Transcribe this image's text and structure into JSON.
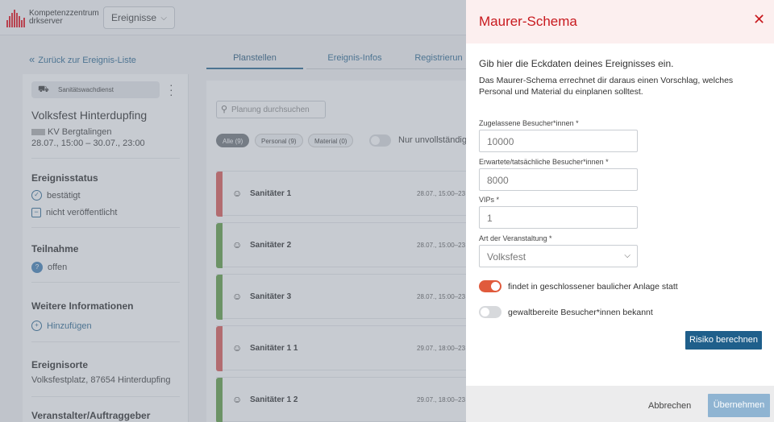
{
  "header": {
    "logo_line1": "Kompetenzzentrum",
    "logo_line2": "drkserver",
    "events_select": "Ereignisse"
  },
  "nav": {
    "back_label": "Zurück zur Ereignis-Liste",
    "tabs": [
      {
        "label": "Planstellen",
        "active": true
      },
      {
        "label": "Ereignis-Infos",
        "active": false
      },
      {
        "label": "Registrierun",
        "active": false
      }
    ]
  },
  "event": {
    "type_chip": "Sanitätswachdienst",
    "title": "Volksfest Hinterdupfing",
    "org": "KV Bergtalingen",
    "dates": "28.07., 15:00 – 30.07., 23:00",
    "status_heading": "Ereignisstatus",
    "status_confirmed": "bestätigt",
    "status_unpublished": "nicht veröffentlicht",
    "participation_heading": "Teilnahme",
    "participation_value": "offen",
    "more_info_heading": "Weitere Informationen",
    "add_label": "Hinzufügen",
    "locations_heading": "Ereignisorte",
    "location_value": "Volksfestplatz, 87654 Hinterdupfing",
    "organizer_heading": "Veranstalter/Auftraggeber"
  },
  "planning": {
    "search_placeholder": "Planung durchsuchen",
    "filters": [
      {
        "label": "Alle (9)",
        "active": true
      },
      {
        "label": "Personal (9)",
        "active": false
      },
      {
        "label": "Material (0)",
        "active": false
      }
    ],
    "incomplete_toggle_label": "Nur unvollständig b",
    "rows": [
      {
        "name": "Sanitäter 1",
        "date": "28.07., 15:00–23",
        "status_color": "#d9534f"
      },
      {
        "name": "Sanitäter 2",
        "date": "28.07., 15:00–23",
        "status_color": "#5a9a3c"
      },
      {
        "name": "Sanitäter 3",
        "date": "28.07., 15:00–23",
        "status_color": "#5a9a3c"
      },
      {
        "name": "Sanitäter 1 1",
        "date": "29.07., 18:00–23",
        "status_color": "#d9534f"
      },
      {
        "name": "Sanitäter 1 2",
        "date": "29.07., 18:00–23",
        "status_color": "#5a9a3c"
      }
    ]
  },
  "dialog": {
    "title": "Maurer-Schema",
    "intro": "Gib hier die Eckdaten deines Ereignisses ein.",
    "description": "Das Maurer-Schema errechnet dir daraus einen Vorschlag, welches Personal und Material du einplanen solltest.",
    "fields": {
      "allowed_visitors_label": "Zugelassene Besucher*innen *",
      "allowed_visitors_value": "10000",
      "expected_visitors_label": "Erwartete/tatsächliche Besucher*innen *",
      "expected_visitors_value": "8000",
      "vips_label": "VIPs *",
      "vips_value": "1",
      "event_type_label": "Art der Veranstaltung *",
      "event_type_value": "Volksfest"
    },
    "switches": {
      "enclosed_label": "findet in geschlossener baulicher Anlage statt",
      "enclosed_on": true,
      "violent_label": "gewaltbereite Besucher*innen bekannt",
      "violent_on": false
    },
    "calculate_label": "Risiko berechnen",
    "cancel_label": "Abbrechen",
    "apply_label": "Übernehmen"
  },
  "colors": {
    "accent": "#1f5f8b",
    "danger_title": "#c8191e",
    "switch_on": "#e05a3c"
  }
}
